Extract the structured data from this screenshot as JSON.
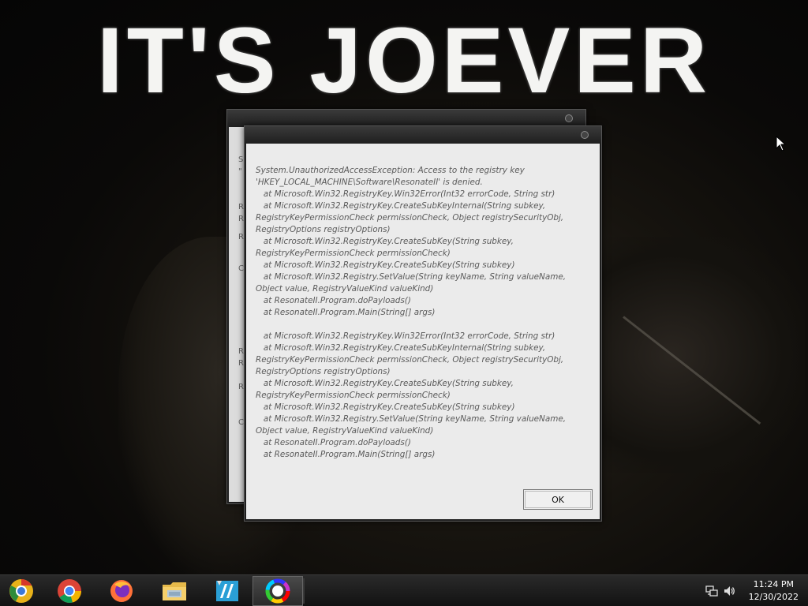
{
  "wallpaper": {
    "title": "IT'S JOEVER"
  },
  "back_window": {
    "visible_letters": [
      "S",
      "\"",
      "R",
      "R",
      "R",
      "C",
      "R",
      "R",
      "R",
      "C"
    ]
  },
  "dialog": {
    "message": "System.UnauthorizedAccessException: Access to the registry key\n'HKEY_LOCAL_MACHINE\\Software\\ResonateII' is denied.\n   at Microsoft.Win32.RegistryKey.Win32Error(Int32 errorCode, String str)\n   at Microsoft.Win32.RegistryKey.CreateSubKeyInternal(String subkey,\nRegistryKeyPermissionCheck permissionCheck, Object registrySecurityObj,\nRegistryOptions registryOptions)\n   at Microsoft.Win32.RegistryKey.CreateSubKey(String subkey,\nRegistryKeyPermissionCheck permissionCheck)\n   at Microsoft.Win32.RegistryKey.CreateSubKey(String subkey)\n   at Microsoft.Win32.Registry.SetValue(String keyName, String valueName,\nObject value, RegistryValueKind valueKind)\n   at ResonateII.Program.doPayloads()\n   at ResonateII.Program.Main(String[] args)\n\n   at Microsoft.Win32.RegistryKey.Win32Error(Int32 errorCode, String str)\n   at Microsoft.Win32.RegistryKey.CreateSubKeyInternal(String subkey,\nRegistryKeyPermissionCheck permissionCheck, Object registrySecurityObj,\nRegistryOptions registryOptions)\n   at Microsoft.Win32.RegistryKey.CreateSubKey(String subkey,\nRegistryKeyPermissionCheck permissionCheck)\n   at Microsoft.Win32.RegistryKey.CreateSubKey(String subkey)\n   at Microsoft.Win32.Registry.SetValue(String keyName, String valueName,\nObject value, RegistryValueKind valueKind)\n   at ResonateII.Program.doPayloads()\n   at ResonateII.Program.Main(String[] args)",
    "ok_label": "OK"
  },
  "taskbar": {
    "apps": [
      {
        "name": "Chrome Canary",
        "icon": "chrome-canary-icon",
        "active": false
      },
      {
        "name": "Google Chrome",
        "icon": "chrome-icon",
        "active": false
      },
      {
        "name": "Firefox",
        "icon": "firefox-icon",
        "active": false
      },
      {
        "name": "File Explorer",
        "icon": "file-explorer-icon",
        "active": false
      },
      {
        "name": "Video Editor",
        "icon": "video-editor-icon",
        "active": false
      },
      {
        "name": "Resonate",
        "icon": "color-wheel-icon",
        "active": true
      }
    ],
    "tray": {
      "time": "11:24 PM",
      "date": "12/30/2022"
    }
  },
  "colors": {
    "taskbar_bg": "#161616",
    "dialog_bg": "#ebebeb",
    "dialog_text": "#5a5a5a"
  }
}
